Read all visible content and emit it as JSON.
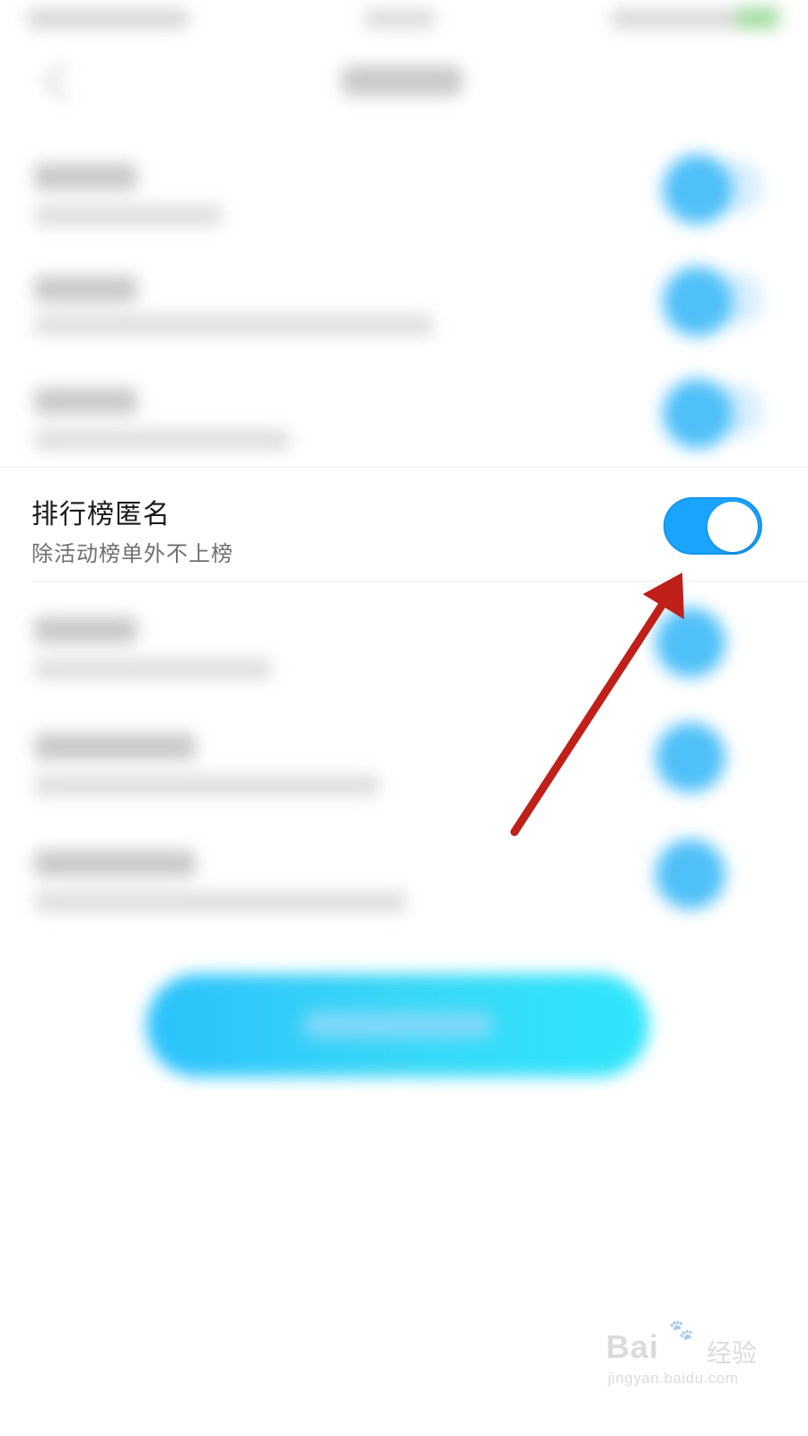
{
  "setting": {
    "title": "排行榜匿名",
    "subtitle": "除活动榜单外不上榜",
    "toggle_on": true
  },
  "colors": {
    "toggle_on": "#1aa3ff",
    "arrow": "#c0201a",
    "button_gradient": [
      "#2bc1fb",
      "#2ee6fb"
    ]
  },
  "watermark": {
    "logo": "Bai",
    "logo_tail": "u",
    "brand": "经验",
    "domain": "jingyan.baidu.com"
  }
}
